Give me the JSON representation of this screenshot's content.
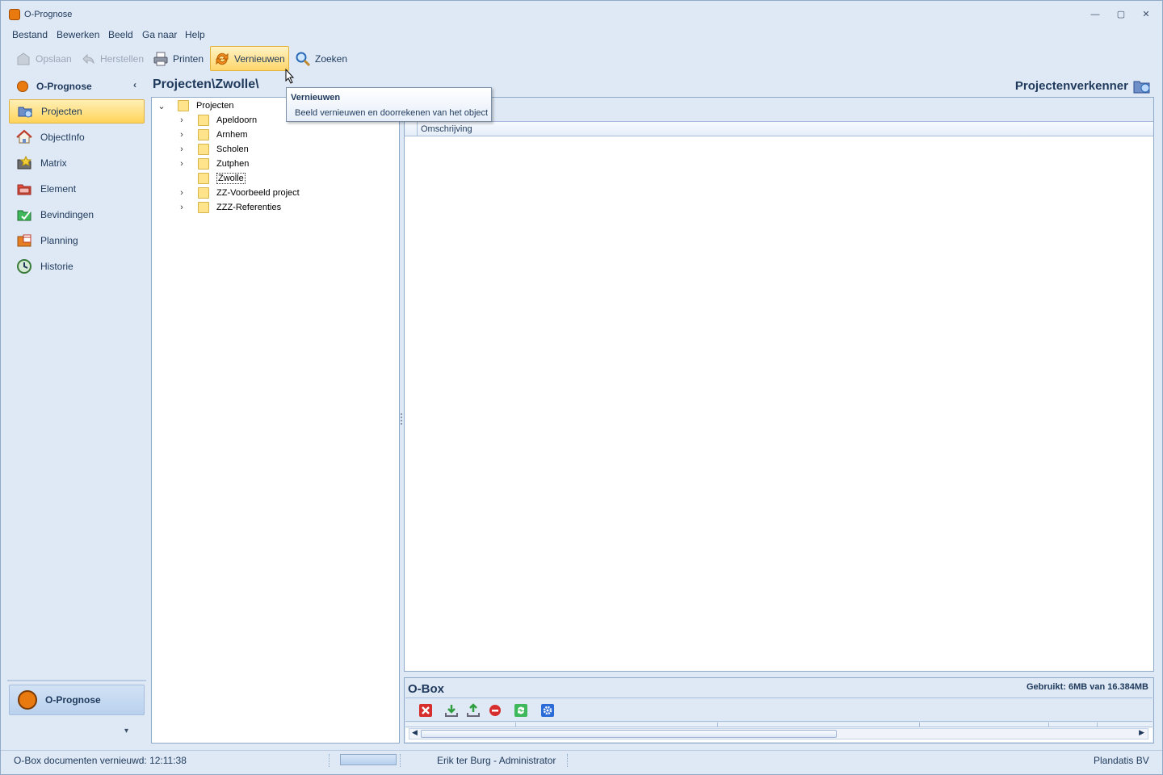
{
  "window": {
    "title": "O-Prognose",
    "min": "—",
    "max": "▢",
    "close": "✕"
  },
  "menu": [
    "Bestand",
    "Bewerken",
    "Beeld",
    "Ga naar",
    "Help"
  ],
  "toolbar": {
    "save": "Opslaan",
    "restore": "Herstellen",
    "print": "Printen",
    "refresh": "Vernieuwen",
    "search": "Zoeken"
  },
  "sidebar": {
    "header": "O-Prognose",
    "collapse_glyph": "‹",
    "items": [
      {
        "label": "Projecten",
        "icon": "projects-icon",
        "active": true
      },
      {
        "label": "ObjectInfo",
        "icon": "house-icon",
        "active": false
      },
      {
        "label": "Matrix",
        "icon": "matrix-icon",
        "active": false
      },
      {
        "label": "Element",
        "icon": "element-icon",
        "active": false
      },
      {
        "label": "Bevindingen",
        "icon": "findings-icon",
        "active": false
      },
      {
        "label": "Planning",
        "icon": "planning-icon",
        "active": false
      },
      {
        "label": "Historie",
        "icon": "history-icon",
        "active": false
      }
    ],
    "bottom_label": "O-Prognose",
    "more_glyph": "▾"
  },
  "breadcrumb": "Projecten\\Zwolle\\",
  "panel_title": "Projectenverkenner",
  "tree": {
    "root": "Projecten",
    "children": [
      "Apeldoorn",
      "Arnhem",
      "Scholen",
      "Zutphen",
      "Zwolle",
      "ZZ-Voorbeeld project",
      "ZZZ-Referenties"
    ],
    "expandable": [
      true,
      true,
      true,
      true,
      false,
      true,
      true
    ],
    "focused_index": 4
  },
  "grid": {
    "columns": [
      "Omschrijving"
    ]
  },
  "tooltip": {
    "title": "Vernieuwen",
    "body": "Beeld vernieuwen en doorrekenen van het object"
  },
  "obox": {
    "title": "O-Box",
    "usage": "Gebruikt: 6MB van 16.384MB"
  },
  "status": {
    "left": "O-Box documenten vernieuwd: 12:11:38",
    "user": "Erik ter Burg - Administrator",
    "company": "Plandatis BV"
  },
  "colors": {
    "accent": "#e87a10",
    "selection": "#ffd45a",
    "chrome": "#dfe9f5"
  }
}
